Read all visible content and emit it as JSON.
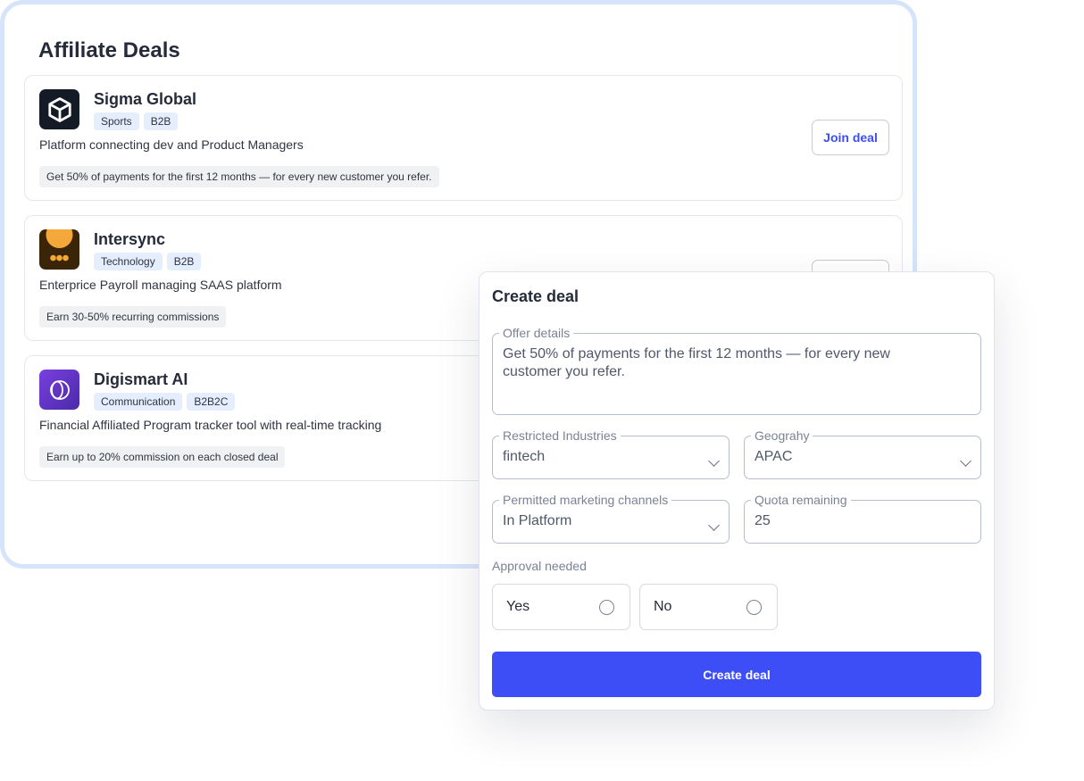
{
  "page": {
    "title": "Affiliate Deals"
  },
  "deals": [
    {
      "name": "Sigma Global",
      "tags": [
        "Sports",
        "B2B"
      ],
      "description": "Platform connecting dev and Product Managers",
      "offer": "Get 50% of payments for the first 12 months — for every new customer you refer.",
      "logo_icon": "cube-icon",
      "logo_color": "#141a26",
      "action": "Join deal"
    },
    {
      "name": "Intersync",
      "tags": [
        "Technology",
        "B2B"
      ],
      "description": "Enterprice Payroll managing SAAS platform",
      "offer": "Earn 30-50% recurring commissions",
      "logo_icon": "sun-dots-icon",
      "logo_color": "#3a2508",
      "action": ""
    },
    {
      "name": "Digismart AI",
      "tags": [
        "Communication",
        "B2B2C"
      ],
      "description": "Financial Affiliated Program tracker tool with real-time tracking",
      "offer": "Earn up to 20% commission on each closed deal",
      "logo_icon": "overlapping-circles-icon",
      "logo_color": "#6a35c9"
    }
  ],
  "modal": {
    "title": "Create deal",
    "offer_label": "Offer details",
    "offer_value": "Get 50% of payments for the first 12 months — for every new customer you refer.",
    "industries_label": "Restricted Industries",
    "industries_value": "fintech",
    "geo_label": "Geograhy",
    "geo_value": "APAC",
    "channels_label": "Permitted marketing channels",
    "channels_value": "In Platform",
    "quota_label": "Quota remaining",
    "quota_value": "25",
    "approval_label": "Approval needed",
    "yes": "Yes",
    "no": "No",
    "submit": "Create deal"
  },
  "colors": {
    "accent": "#3d4ef7",
    "tag_bg": "#e5eefc",
    "panel_border": "#d6e4fb"
  }
}
